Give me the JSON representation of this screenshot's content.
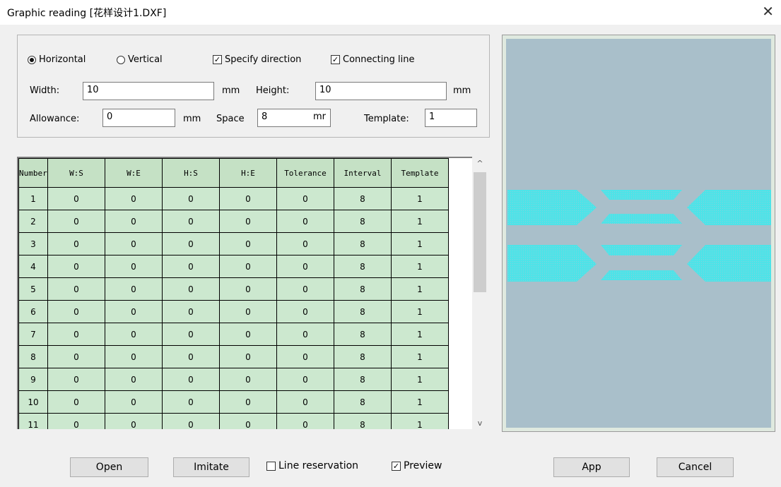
{
  "window": {
    "title": "Graphic reading [花样设计1.DXF]",
    "close_glyph": "✕"
  },
  "options": {
    "horizontal_label": "Horizontal",
    "horizontal_selected": true,
    "vertical_label": "Vertical",
    "vertical_selected": false,
    "specify_direction_label": "Specify direction",
    "specify_direction_checked": true,
    "connecting_line_label": "Connecting line",
    "connecting_line_checked": true,
    "width_label": "Width:",
    "width_value": "10",
    "width_unit": "mm",
    "height_label": "Height:",
    "height_value": "10",
    "height_unit": "mm",
    "allowance_label": "Allowance:",
    "allowance_value": "0",
    "allowance_unit": "mm",
    "space_label": "Space",
    "space_value": "8",
    "space_unit": "mr",
    "template_label": "Template:",
    "template_value": "1"
  },
  "table": {
    "columns": [
      "Number",
      "W:S",
      "W:E",
      "H:S",
      "H:E",
      "Tolerance",
      "Interval",
      "Template"
    ],
    "rows": [
      [
        "1",
        "0",
        "0",
        "0",
        "0",
        "0",
        "8",
        "1"
      ],
      [
        "2",
        "0",
        "0",
        "0",
        "0",
        "0",
        "8",
        "1"
      ],
      [
        "3",
        "0",
        "0",
        "0",
        "0",
        "0",
        "8",
        "1"
      ],
      [
        "4",
        "0",
        "0",
        "0",
        "0",
        "0",
        "8",
        "1"
      ],
      [
        "5",
        "0",
        "0",
        "0",
        "0",
        "0",
        "8",
        "1"
      ],
      [
        "6",
        "0",
        "0",
        "0",
        "0",
        "0",
        "8",
        "1"
      ],
      [
        "7",
        "0",
        "0",
        "0",
        "0",
        "0",
        "8",
        "1"
      ],
      [
        "8",
        "0",
        "0",
        "0",
        "0",
        "0",
        "8",
        "1"
      ],
      [
        "9",
        "0",
        "0",
        "0",
        "0",
        "0",
        "8",
        "1"
      ],
      [
        "10",
        "0",
        "0",
        "0",
        "0",
        "0",
        "8",
        "1"
      ],
      [
        "11",
        "0",
        "0",
        "0",
        "0",
        "0",
        "8",
        "1"
      ]
    ],
    "scroll_up_glyph": "^",
    "scroll_down_glyph": "v"
  },
  "footer": {
    "open_label": "Open",
    "imitate_label": "Imitate",
    "line_reservation_label": "Line reservation",
    "line_reservation_checked": false,
    "preview_label": "Preview",
    "preview_checked": true,
    "app_label": "App",
    "cancel_label": "Cancel"
  },
  "colors": {
    "pattern_fill": "#4ee3e8",
    "preview_bg": "#a9bfca",
    "grid_cell": "#cce8cf"
  }
}
